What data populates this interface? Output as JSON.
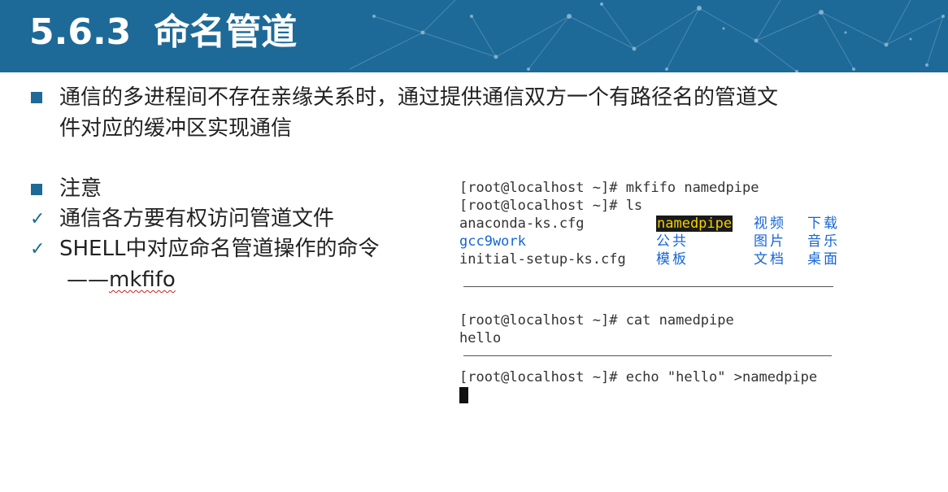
{
  "slide": {
    "section_number": "5.6.3",
    "title": "命名管道",
    "bullets": {
      "b1_line1": "通信的多进程间不存在亲缘关系时，通过提供通信双方一个有路径名的管道文",
      "b1_line2": "件对应的缓冲区实现通信",
      "b2": "注意",
      "c1": "通信各方要有权访问管道文件",
      "c2": "SHELL中对应命名管道操作的命令",
      "c3_dash": "——",
      "c3_cmd": "mkfifo"
    },
    "colors": {
      "banner": "#1d6a98",
      "bullet_square": "#1d6a98",
      "link_blue": "#1565d8",
      "highlight_bg": "#1a1a1a",
      "highlight_fg": "#f5d000"
    },
    "icons": {
      "bullet": "square-bullet-icon",
      "check": "check-mark-icon"
    }
  },
  "terminal": {
    "t1": {
      "line1": "[root@localhost ~]# mkfifo namedpipe",
      "line2": "[root@localhost ~]# ls",
      "ls": {
        "r1c1": "anaconda-ks.cfg",
        "r1c2": "namedpipe",
        "r1c3": "视频",
        "r1c4": "下载",
        "r2c1": "gcc9work",
        "r2c2": "公共",
        "r2c3": "图片",
        "r2c4": "音乐",
        "r3c1": "initial-setup-ks.cfg",
        "r3c2": "模板",
        "r3c3": "文档",
        "r3c4": "桌面"
      }
    },
    "t2": {
      "line1": "[root@localhost ~]# cat namedpipe",
      "line2": "hello"
    },
    "t3": {
      "line1": "[root@localhost ~]# echo \"hello\" >namedpipe"
    }
  }
}
